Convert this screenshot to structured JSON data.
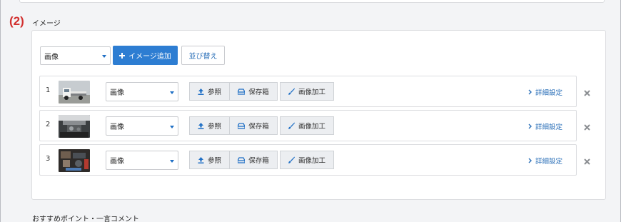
{
  "section": {
    "marker": "(2)",
    "label": "イメージ"
  },
  "toolbar": {
    "type_select": "画像",
    "add_button": "イメージ追加",
    "sort_button": "並び替え"
  },
  "rows": [
    {
      "index": "1",
      "type": "画像",
      "thumbnail": "white-truck-photo",
      "browse": "参照",
      "storage": "保存箱",
      "edit": "画像加工",
      "detail": "詳細設定"
    },
    {
      "index": "2",
      "type": "画像",
      "thumbnail": "engine-bay-photo",
      "browse": "参照",
      "storage": "保存箱",
      "edit": "画像加工",
      "detail": "詳細設定"
    },
    {
      "index": "3",
      "type": "画像",
      "thumbnail": "engine-parts-photo",
      "browse": "参照",
      "storage": "保存箱",
      "edit": "画像加工",
      "detail": "詳細設定"
    }
  ],
  "next_section": {
    "label": "おすすめポイント・一言コメント"
  },
  "colors": {
    "accent": "#2d7dd2",
    "link": "#2a6fb8",
    "marker": "#d2302f"
  },
  "icons": [
    "upload-icon",
    "drive-icon",
    "brush-icon",
    "chevron-right-icon",
    "close-icon",
    "plus-icon",
    "caret-down-icon"
  ]
}
